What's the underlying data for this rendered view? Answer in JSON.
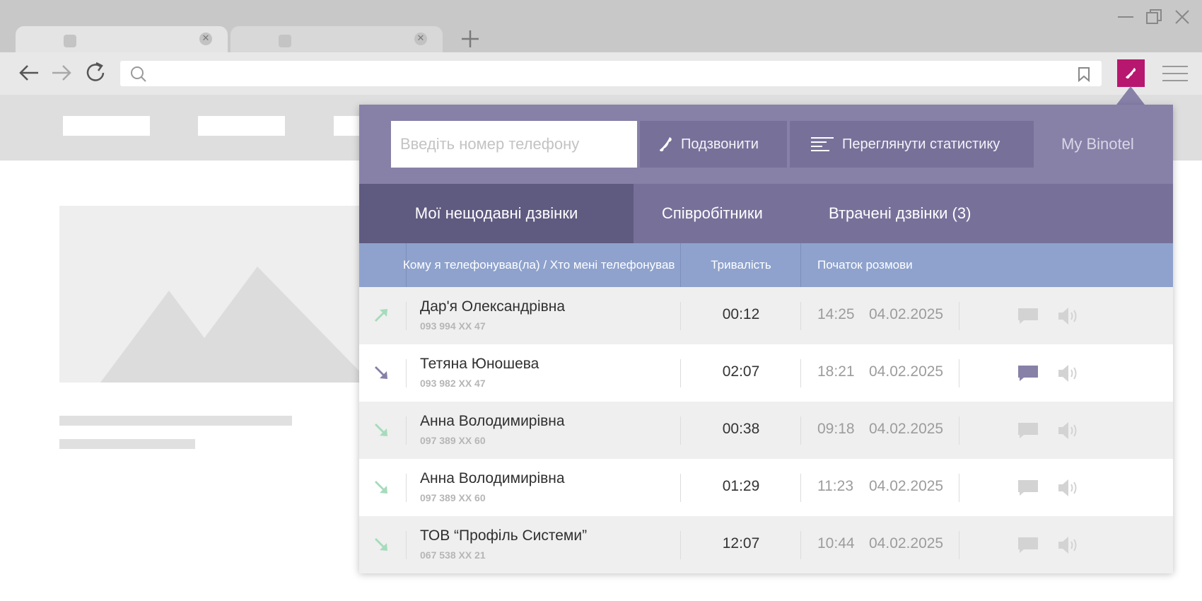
{
  "colors": {
    "brand": "#b8176f",
    "popup_header": "#8781a8",
    "tabs_bg": "#77719a",
    "active_tab": "#5f5a80",
    "table_header": "#8ea2cd",
    "outgoing_arrow": "#a6dbbb",
    "incoming_arrow": "#8781a8",
    "comment_active": "#8781a8"
  },
  "popup": {
    "phone_placeholder": "Введіть номер телефону",
    "call_button": "Подзвонити",
    "stats_button": "Переглянути статистику",
    "my_binotel": "My Binotel",
    "tabs": [
      {
        "label": "Мої нещодавні дзвінки",
        "active": true
      },
      {
        "label": "Співробітники",
        "active": false
      },
      {
        "label": "Втрачені дзвінки (3)",
        "active": false
      }
    ],
    "columns": {
      "contact": "Кому я телефонував(ла) / Хто мені телефонував",
      "duration": "Тривалість",
      "start": "Початок розмови"
    },
    "calls": [
      {
        "name": "Дар'я Олександрівна",
        "number": "093 994 XX 47",
        "duration": "00:12",
        "time": "14:25",
        "date": "04.02.2025",
        "direction": "outgoing",
        "has_comment": false
      },
      {
        "name": "Тетяна Юношева",
        "number": "093 982 XX 47",
        "duration": "02:07",
        "time": "18:21",
        "date": "04.02.2025",
        "direction": "incoming-missed",
        "has_comment": true
      },
      {
        "name": "Анна Володимирівна",
        "number": "097 389 XX 60",
        "duration": "00:38",
        "time": "09:18",
        "date": "04.02.2025",
        "direction": "incoming",
        "has_comment": false
      },
      {
        "name": "Анна Володимирівна",
        "number": "097 389 XX 60",
        "duration": "01:29",
        "time": "11:23",
        "date": "04.02.2025",
        "direction": "incoming",
        "has_comment": false
      },
      {
        "name": "ТОВ “Профіль Системи”",
        "number": "067 538 XX 21",
        "duration": "12:07",
        "time": "10:44",
        "date": "04.02.2025",
        "direction": "incoming",
        "has_comment": false
      }
    ]
  }
}
